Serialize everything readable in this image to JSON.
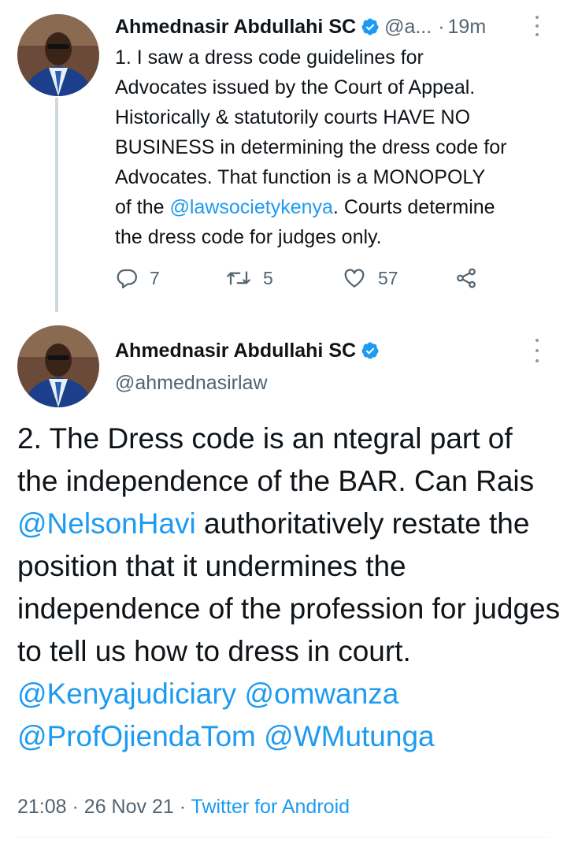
{
  "colors": {
    "link": "#1d9bf0",
    "muted": "#536471",
    "verified": "#1d9bf0",
    "text": "#0f1419"
  },
  "tweet1": {
    "author_name": "Ahmednasir Abdullahi SC",
    "author_handle": "@a...",
    "separator": "·",
    "time": "19m",
    "avatar_icon": "profile-photo",
    "verified_icon": "verified-badge-icon",
    "text_before_mention": "1. I saw a dress code guidelines for\nAdvocates issued by the Court of Appeal.\nHistorically & statutorily courts HAVE NO\nBUSINESS in determining the dress code for\nAdvocates. That function is a MONOPOLY\nof the ",
    "mention": "@lawsocietykenya",
    "text_after_mention": ". Courts determine\nthe dress code for judges only.",
    "replies": "7",
    "retweets": "5",
    "likes": "57",
    "actions_icons": [
      "reply-icon",
      "retweet-icon",
      "like-icon",
      "share-icon"
    ]
  },
  "tweet2": {
    "author_name": "Ahmednasir Abdullahi SC",
    "author_handle": "@ahmednasirlaw",
    "avatar_icon": "profile-photo",
    "verified_icon": "verified-badge-icon",
    "text_part1": "2. The Dress code is an ntegral part of the independence of the BAR. Can Rais ",
    "mention1": "@NelsonHavi",
    "text_part2": " authoritatively restate the position that it undermines the independence of the profession for judges to tell us how to dress in court. ",
    "mention2": "@Kenyajudiciary",
    "mention3": "@omwanza",
    "mention4": "@ProfOjiendaTom",
    "mention5": "@WMutunga",
    "time": "21:08",
    "date": "26 Nov 21",
    "source": "Twitter for Android",
    "meta_separator": "·"
  }
}
